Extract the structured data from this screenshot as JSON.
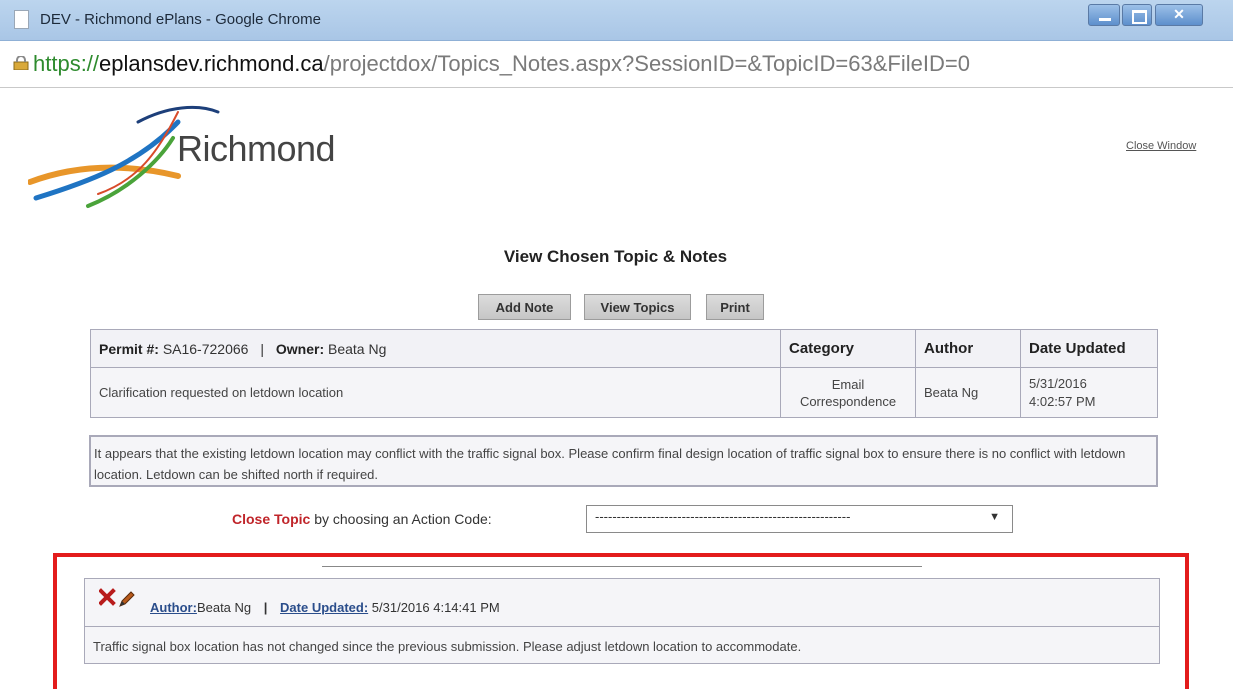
{
  "window": {
    "title": "DEV - Richmond ePlans - Google Chrome"
  },
  "address": {
    "scheme": "https://",
    "host": "eplansdev.richmond.ca",
    "path": "/projectdox/Topics_Notes.aspx?SessionID=&TopicID=63&FileID=0"
  },
  "brand": {
    "name": "Richmond",
    "colors": {
      "orange": "#e8962a",
      "blue": "#1f74c3",
      "green": "#4aa33a",
      "navy": "#1d3f7a"
    }
  },
  "header": {
    "close_window": "Close Window"
  },
  "page": {
    "heading": "View Chosen Topic & Notes"
  },
  "toolbar": {
    "add_note": "Add Note",
    "view_topics": "View Topics",
    "print": "Print"
  },
  "topic": {
    "permit_label": "Permit #:",
    "permit_value": "SA16-722066",
    "owner_label": "Owner:",
    "owner_value": "Beata Ng",
    "headers": {
      "category": "Category",
      "author": "Author",
      "date_updated": "Date Updated"
    },
    "subject": "Clarification requested on letdown location",
    "category_line1": "Email",
    "category_line2": "Correspondence",
    "author": "Beata Ng",
    "date_line1": "5/31/2016",
    "date_line2": "4:02:57 PM",
    "description": "It appears that the existing letdown location may conflict with the traffic signal box. Please confirm final design location of traffic signal box to ensure there is no conflict with letdown location. Letdown can be shifted north if required."
  },
  "close_topic": {
    "label": "Close Topic",
    "suffix": "by choosing an Action Code:",
    "selected": "-----------------------------------------------------------"
  },
  "note": {
    "author_label": "Author:",
    "author_value": "Beata Ng",
    "date_label": "Date Updated:",
    "date_value": "5/31/2016 4:14:41 PM",
    "text": "Traffic signal box location has not changed since the previous submission. Please adjust letdown location to accommodate."
  }
}
